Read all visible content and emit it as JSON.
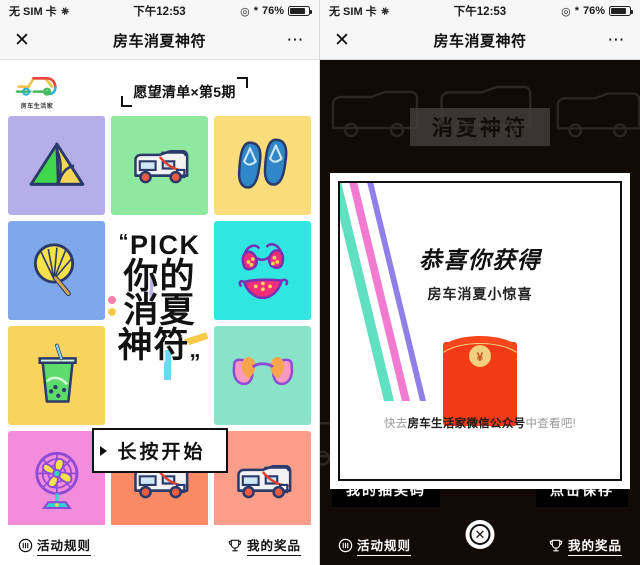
{
  "status_bar": {
    "carrier": "无 SIM 卡",
    "carrier_icon": "network-loop-icon",
    "time": "下午12:53",
    "location_icon": "location-services-icon",
    "bluetooth_icon": "bluetooth-icon",
    "battery_text": "76%",
    "battery_icon": "battery-icon"
  },
  "nav": {
    "close_icon": "close-icon",
    "title": "房车消夏神符",
    "more_icon": "more-options-icon"
  },
  "brand": {
    "logo_icon": "rv-brand-logo-icon",
    "logo_name": "房车生活家",
    "wishlist_title": "愿望清单×第5期"
  },
  "grid": {
    "tiles": [
      {
        "icon": "tent-icon",
        "label": "帐篷",
        "bg": "#b6aee8"
      },
      {
        "icon": "rv-icon",
        "label": "房车",
        "bg": "#8fe8a0"
      },
      {
        "icon": "flip-flops-icon",
        "label": "人字拖",
        "bg": "#f8dd7a"
      },
      {
        "icon": "hand-fan-icon",
        "label": "蒲扇",
        "bg": "#7fa8ea"
      },
      {
        "icon": "copy-block",
        "label": "文案",
        "bg": "#ffffff"
      },
      {
        "icon": "bikini-icon",
        "label": "比基尼",
        "bg": "#2fe6e0"
      },
      {
        "icon": "drink-cup-icon",
        "label": "冷饮",
        "bg": "#f8d45e"
      },
      {
        "icon": "copy-block",
        "label": "文案",
        "bg": "#ffffff"
      },
      {
        "icon": "sunglasses-icon",
        "label": "墨镜",
        "bg": "#8ae3c8"
      },
      {
        "icon": "electric-fan-icon",
        "label": "电风扇",
        "bg": "#f48cdc"
      },
      {
        "icon": "rv-icon",
        "label": "房车",
        "bg": "#fa8a64"
      },
      {
        "icon": "rv-icon",
        "label": "房车",
        "bg": "#fa9e8a"
      }
    ]
  },
  "copy": {
    "open_quote": "“",
    "pick": "PICK",
    "line1": "你的",
    "line2": "消夏",
    "line3": "神符",
    "close_quote": "„",
    "long_press_button": "长按开始"
  },
  "bottom_bar": {
    "rules_icon": "rules-info-icon",
    "rules_label": "活动规则",
    "prizes_icon": "trophy-icon",
    "prizes_label": "我的奖品"
  },
  "modal": {
    "heading": "恭喜你获得",
    "subheading": "房车消夏小惊喜",
    "envelope_icon": "red-envelope-icon",
    "envelope_seal_symbol": "¥",
    "footer_prefix": "快去",
    "footer_highlight": "房车生活家微信公众号",
    "footer_suffix": "中查看吧!",
    "close_icon": "close-circle-icon",
    "stripe_colors": [
      "#5fe0c0",
      "#f27ad0",
      "#8f7fe8"
    ]
  },
  "background_behind_modal": {
    "ghost_title": "消夏神符",
    "left_button": "我的抽奖码",
    "right_button": "点击保存"
  },
  "theme": {
    "accent_red": "#f23b16",
    "gold": "#f2cf7e",
    "ink": "#111111",
    "statusbar_bg": "#f7f7f7"
  }
}
